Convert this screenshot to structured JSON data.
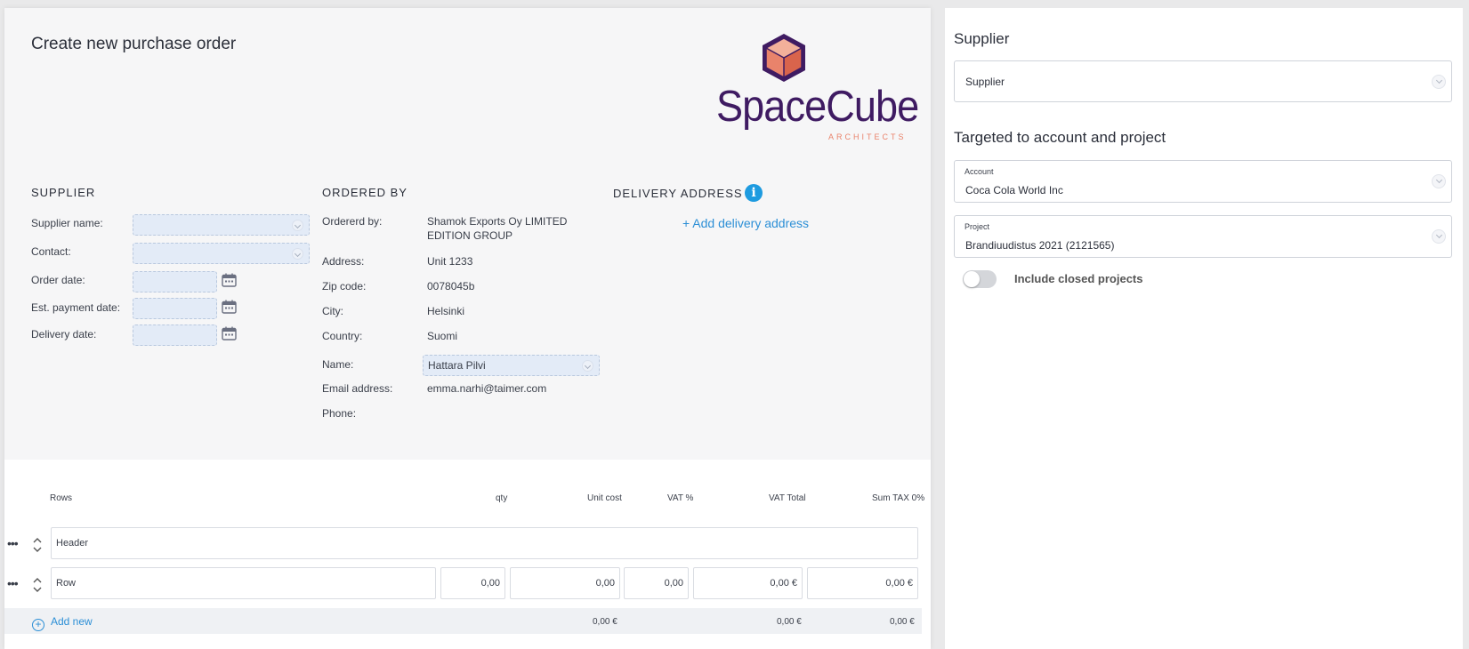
{
  "page": {
    "title": "Create new purchase order"
  },
  "logo": {
    "name": "SpaceCube",
    "subtitle": "ARCHITECTS",
    "colors": {
      "purple": "#3f1b62",
      "coral": "#e9836b"
    }
  },
  "supplier_section": {
    "heading": "SUPPLIER",
    "fields": {
      "supplier_name_label": "Supplier name:",
      "contact_label": "Contact:",
      "order_date_label": "Order date:",
      "est_payment_date_label": "Est. payment date:",
      "delivery_date_label": "Delivery date:"
    }
  },
  "ordered_by": {
    "heading": "ORDERED BY",
    "labels": {
      "ordered_by": "Ordererd by:",
      "address": "Address:",
      "zip": "Zip code:",
      "city": "City:",
      "country": "Country:",
      "name": "Name:",
      "email": "Email address:",
      "phone": "Phone:"
    },
    "values": {
      "ordered_by_line1": "Shamok Exports Oy LIMITED",
      "ordered_by_line2": "EDITION GROUP",
      "address": "Unit 1233",
      "zip": "0078045b",
      "city": "Helsinki",
      "country": "Suomi",
      "name": "Hattara Pilvi",
      "email": "emma.narhi@taimer.com",
      "phone": ""
    }
  },
  "delivery": {
    "heading": "DELIVERY ADDRESS",
    "info_icon": "i",
    "add_link": "+ Add delivery address"
  },
  "rows_table": {
    "columns": {
      "rows": "Rows",
      "qty": "qty",
      "unit_cost": "Unit cost",
      "vat_pct": "VAT %",
      "vat_total": "VAT Total",
      "sum_tax": "Sum TAX 0%"
    },
    "header_row": {
      "text": "Header"
    },
    "row": {
      "text": "Row",
      "qty": "0,00",
      "unit_cost": "0,00",
      "vat_pct": "0,00",
      "vat_total": "0,00 €",
      "sum_tax": "0,00 €"
    },
    "footer": {
      "add_new": "Add new",
      "unit_cost_total": "0,00 €",
      "vat_total": "0,00 €",
      "sum_tax": "0,00 €"
    }
  },
  "right_panel": {
    "supplier_title": "Supplier",
    "supplier_select": {
      "placeholder": "Supplier"
    },
    "target_title": "Targeted to account and project",
    "account": {
      "label": "Account",
      "value": "Coca Cola World Inc"
    },
    "project": {
      "label": "Project",
      "value": "Brandiuudistus 2021 (2121565)"
    },
    "include_closed": {
      "label": "Include closed projects",
      "enabled": false
    }
  }
}
